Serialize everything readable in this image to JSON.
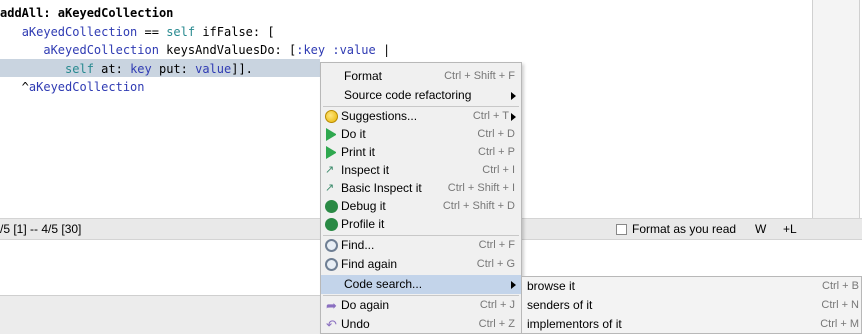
{
  "editor": {
    "lines": [
      {
        "parts": [
          {
            "t": "addAll: ",
            "c": "tok-sel"
          },
          {
            "t": "aKeyedCollection",
            "c": "tok-sel"
          }
        ]
      },
      {
        "parts": [
          {
            "t": "   ",
            "c": "tok-plain"
          },
          {
            "t": "aKeyedCollection",
            "c": "tok-var"
          },
          {
            "t": " == ",
            "c": "tok-plain"
          },
          {
            "t": "self",
            "c": "tok-self"
          },
          {
            "t": " ifFalse: [",
            "c": "tok-plain"
          }
        ]
      },
      {
        "parts": [
          {
            "t": "      ",
            "c": "tok-plain"
          },
          {
            "t": "aKeyedCollection",
            "c": "tok-var"
          },
          {
            "t": " keysAndValuesDo: [",
            "c": "tok-plain"
          },
          {
            "t": ":key :value",
            "c": "tok-var"
          },
          {
            "t": " |",
            "c": "tok-plain"
          }
        ]
      },
      {
        "parts": [
          {
            "t": "         ",
            "c": "tok-plain"
          },
          {
            "t": "self",
            "c": "tok-self"
          },
          {
            "t": " at: ",
            "c": "tok-plain"
          },
          {
            "t": "key",
            "c": "tok-var"
          },
          {
            "t": " put: ",
            "c": "tok-plain"
          },
          {
            "t": "value",
            "c": "tok-var"
          },
          {
            "t": "]].",
            "c": "tok-plain"
          }
        ]
      },
      {
        "parts": [
          {
            "t": "   ^",
            "c": "tok-plain"
          },
          {
            "t": "aKeyedCollection",
            "c": "tok-var"
          }
        ]
      }
    ]
  },
  "status": {
    "position": "/5 [1] -- 4/5 [30]",
    "format_label": "Format as you read",
    "w_label": "W",
    "plus_l_label": "+L"
  },
  "context_menu": {
    "format": {
      "label": "Format",
      "shortcut": "Ctrl + Shift + F"
    },
    "refactoring": {
      "label": "Source code refactoring"
    },
    "suggestions": {
      "label": "Suggestions...",
      "shortcut": "Ctrl + T"
    },
    "do_it": {
      "label": "Do it",
      "shortcut": "Ctrl + D"
    },
    "print_it": {
      "label": "Print it",
      "shortcut": "Ctrl + P"
    },
    "inspect_it": {
      "label": "Inspect it",
      "shortcut": "Ctrl + I"
    },
    "basic_inspect": {
      "label": "Basic Inspect it",
      "shortcut": "Ctrl + Shift + I"
    },
    "debug_it": {
      "label": "Debug it",
      "shortcut": "Ctrl + Shift + D"
    },
    "profile_it": {
      "label": "Profile it"
    },
    "find": {
      "label": "Find...",
      "shortcut": "Ctrl + F"
    },
    "find_again": {
      "label": "Find again",
      "shortcut": "Ctrl + G"
    },
    "code_search": {
      "label": "Code search..."
    },
    "do_again": {
      "label": "Do again",
      "shortcut": "Ctrl + J"
    },
    "undo": {
      "label": "Undo",
      "shortcut": "Ctrl + Z"
    }
  },
  "sub_menu": {
    "browse_it": {
      "label": "browse it",
      "shortcut": "Ctrl + B"
    },
    "senders_of_it": {
      "label": "senders of it",
      "shortcut": "Ctrl + N"
    },
    "implementors_of_it": {
      "label": "implementors of it",
      "shortcut": "Ctrl + M"
    }
  }
}
